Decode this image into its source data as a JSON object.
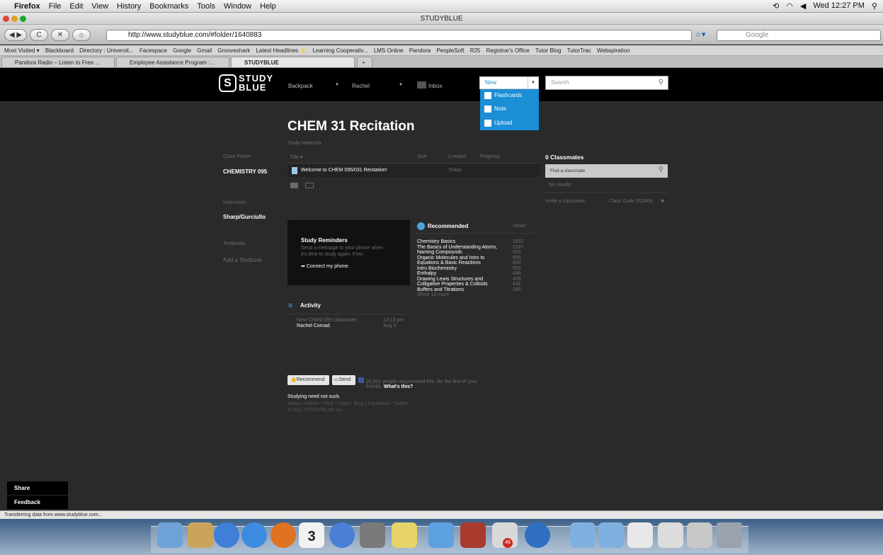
{
  "menubar": {
    "app": "Firefox",
    "items": [
      "File",
      "Edit",
      "View",
      "History",
      "Bookmarks",
      "Tools",
      "Window",
      "Help"
    ],
    "clock": "Wed 12:27 PM"
  },
  "window": {
    "title": "STUDYBLUE"
  },
  "nav": {
    "url": "http://www.studyblue.com/#folder/1640883",
    "search_placeholder": "Google"
  },
  "bookmarks": [
    "Most Visited ▾",
    "Blackboard",
    "Directory : Universit...",
    "Facespace",
    "Google",
    "Gmail",
    "Grooveshark",
    "Latest Headlines ⚡",
    "Learning Cooperativ...",
    "LMS Online",
    "Pandora",
    "PeopleSoft",
    "R25",
    "Registrar's Office",
    "Tutor Blog",
    "TutorTrac",
    "Webspiration"
  ],
  "tabs": [
    "Pandora Radio – Listen to Free ...",
    "Employee Assistance Program :...",
    "STUDYBLUE"
  ],
  "site": {
    "logo_line1": "STUDY",
    "logo_line2": "BLUE",
    "backpack": "Backpack",
    "user": "Rachel",
    "inbox": "Inbox",
    "new": "New",
    "new_menu": [
      "Flashcards",
      "Note",
      "Upload"
    ],
    "search_placeholder": "Search"
  },
  "page": {
    "title": "CHEM 31 Recitation",
    "subtitle": "Study Materials",
    "class_folder_label": "Class Folder",
    "class_folder": "CHEMISTRY 095",
    "instructors_label": "Instructors",
    "instructors": "Sharp/Gurciullo",
    "textbooks_label": "Textbooks",
    "add_textbook": "Add a Textbook",
    "columns": [
      "Title ▾",
      "Size",
      "Created",
      "Progress"
    ],
    "file": {
      "title": "Welcome to CHEM 095/031 Recitation!",
      "size": "-",
      "created": "Today"
    }
  },
  "reminders": {
    "title": "Study Reminders",
    "text1": "Send a message to your phone when",
    "text2": "it's time to study again. Free.",
    "link": "➡ Connect my phone."
  },
  "recommended": {
    "title": "Recommended",
    "views_label": "Views",
    "items": [
      {
        "name": "Chemistry Basics",
        "views": "1652"
      },
      {
        "name": "The Basics of Understanding Atoms,",
        "views": "1197"
      },
      {
        "name": "Naming Compounds",
        "views": "953"
      },
      {
        "name": "Organic Molecules and Intro to",
        "views": "855"
      },
      {
        "name": "Equations & Basic Reactions",
        "views": "606"
      },
      {
        "name": "Intro Biochemistry",
        "views": "550"
      },
      {
        "name": "Enthalpy",
        "views": "496"
      },
      {
        "name": "Drawing Lewis Structures and",
        "views": "409"
      },
      {
        "name": "Colligative Properties & Colloids",
        "views": "431"
      },
      {
        "name": "Buffers and Titrations",
        "views": "345"
      }
    ],
    "more": "Show 10 more."
  },
  "activity": {
    "title": "Activity",
    "line1": "New CHEM 095 classmate:",
    "time1": "12:13 pm",
    "line2": "Rachel Conrad",
    "time2": "Aug 3"
  },
  "classmates": {
    "title": "0 Classmates",
    "find_placeholder": "Find a classmate",
    "no_results": "No results",
    "invite": "Invite a classmate.",
    "class_code": "Class Code 252869"
  },
  "footer": {
    "recommend": "Recommend",
    "send": "Send",
    "fb_text": "20,901 people recommend this. Be the first of your",
    "fb_text2": "friends.",
    "whats_this": "What's this?",
    "tagline": "Studying need not suck.",
    "links": "About / Mobile / FAQ / Legal / Blog / Facebook / Twitter",
    "copyright": "© 2011 STUDYBLUE Inc."
  },
  "side_tabs": {
    "share": "Share",
    "feedback": "Feedback"
  },
  "status": "Transferring data from www.studyblue.com...",
  "dock_badges": {
    "calendar": "3",
    "ical_badge": "46"
  }
}
